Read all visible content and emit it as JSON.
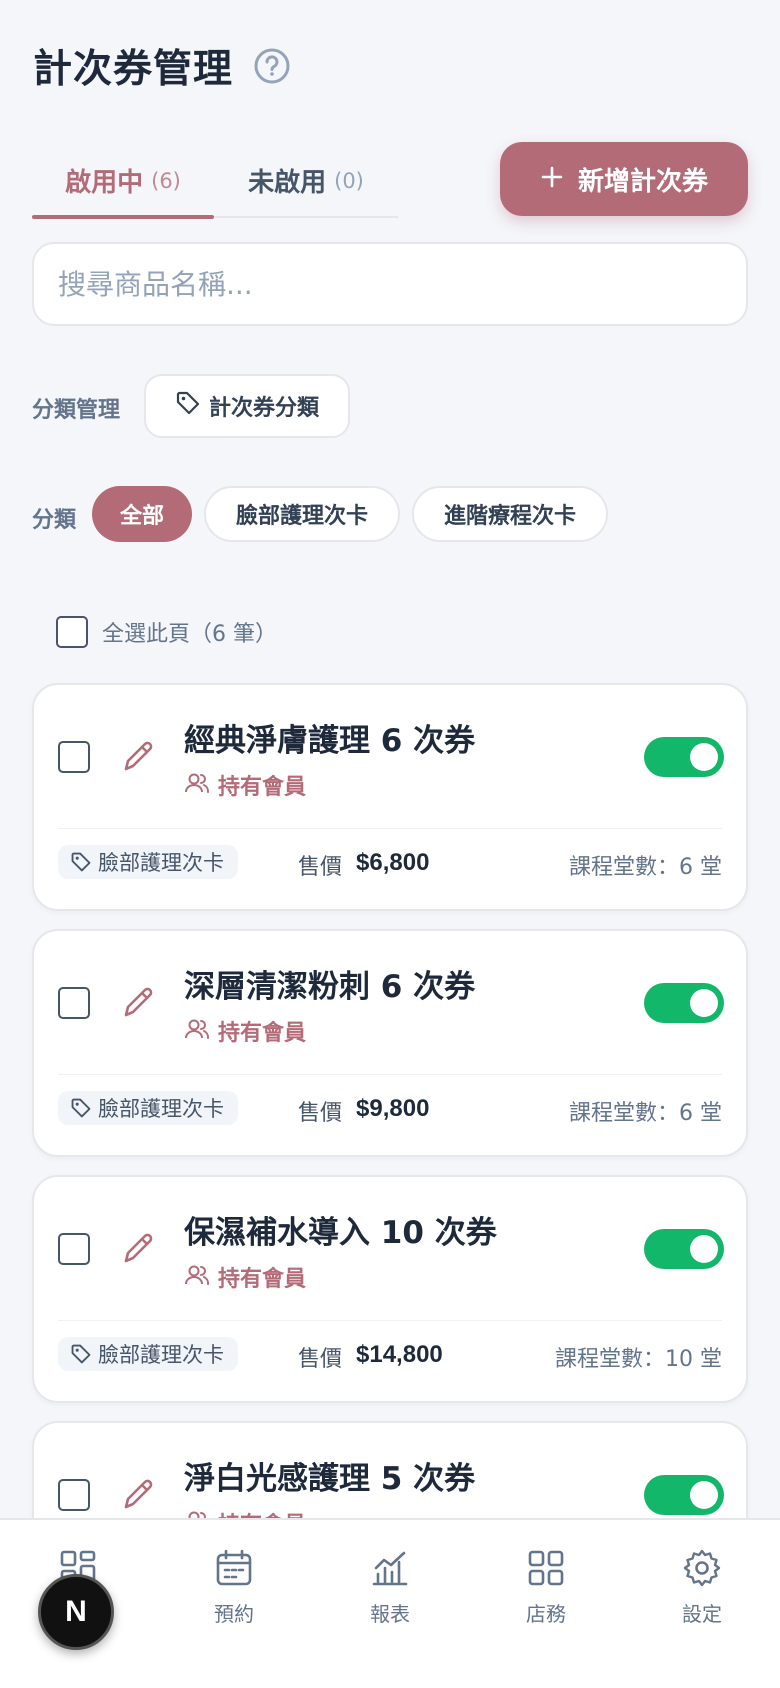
{
  "header": {
    "title": "計次券管理"
  },
  "tabs": [
    {
      "label": "啟用中",
      "count": "(6)"
    },
    {
      "label": "未啟用",
      "count": "(0)"
    }
  ],
  "add_button": {
    "label": "新增計次券"
  },
  "search": {
    "placeholder": "搜尋商品名稱..."
  },
  "category_manage": {
    "label": "分類管理",
    "button_label": "計次券分類"
  },
  "filter": {
    "label": "分類",
    "chips": [
      "全部",
      "臉部護理次卡",
      "進階療程次卡"
    ],
    "selected": "全部"
  },
  "select_all": {
    "label": "全選此頁（6 筆）"
  },
  "cards": [
    {
      "name": "經典淨膚護理 6 次券",
      "audience": "持有會員",
      "category": "臉部護理次卡",
      "price_label": "售價",
      "price": "$6,800",
      "sessions": "課程堂數：6 堂",
      "enabled": true
    },
    {
      "name": "深層清潔粉刺 6 次券",
      "audience": "持有會員",
      "category": "臉部護理次卡",
      "price_label": "售價",
      "price": "$9,800",
      "sessions": "課程堂數：6 堂",
      "enabled": true
    },
    {
      "name": "保濕補水導入 10 次券",
      "audience": "持有會員",
      "category": "臉部護理次卡",
      "price_label": "售價",
      "price": "$14,800",
      "sessions": "課程堂數：10 堂",
      "enabled": true
    },
    {
      "name": "淨白光感護理 5 次券",
      "audience": "持有會員",
      "enabled": true
    }
  ],
  "bottom_nav": [
    {
      "label": "",
      "icon": "dashboard-icon"
    },
    {
      "label": "預約",
      "icon": "calendar-icon"
    },
    {
      "label": "報表",
      "icon": "chart-icon"
    },
    {
      "label": "店務",
      "icon": "grid-icon"
    },
    {
      "label": "設定",
      "icon": "gear-icon"
    }
  ],
  "floating_badge": {
    "text": "N"
  },
  "colors": {
    "accent": "#b46b78",
    "toggle_on": "#12b76a",
    "text": "#1e293b",
    "muted": "#64748b"
  }
}
